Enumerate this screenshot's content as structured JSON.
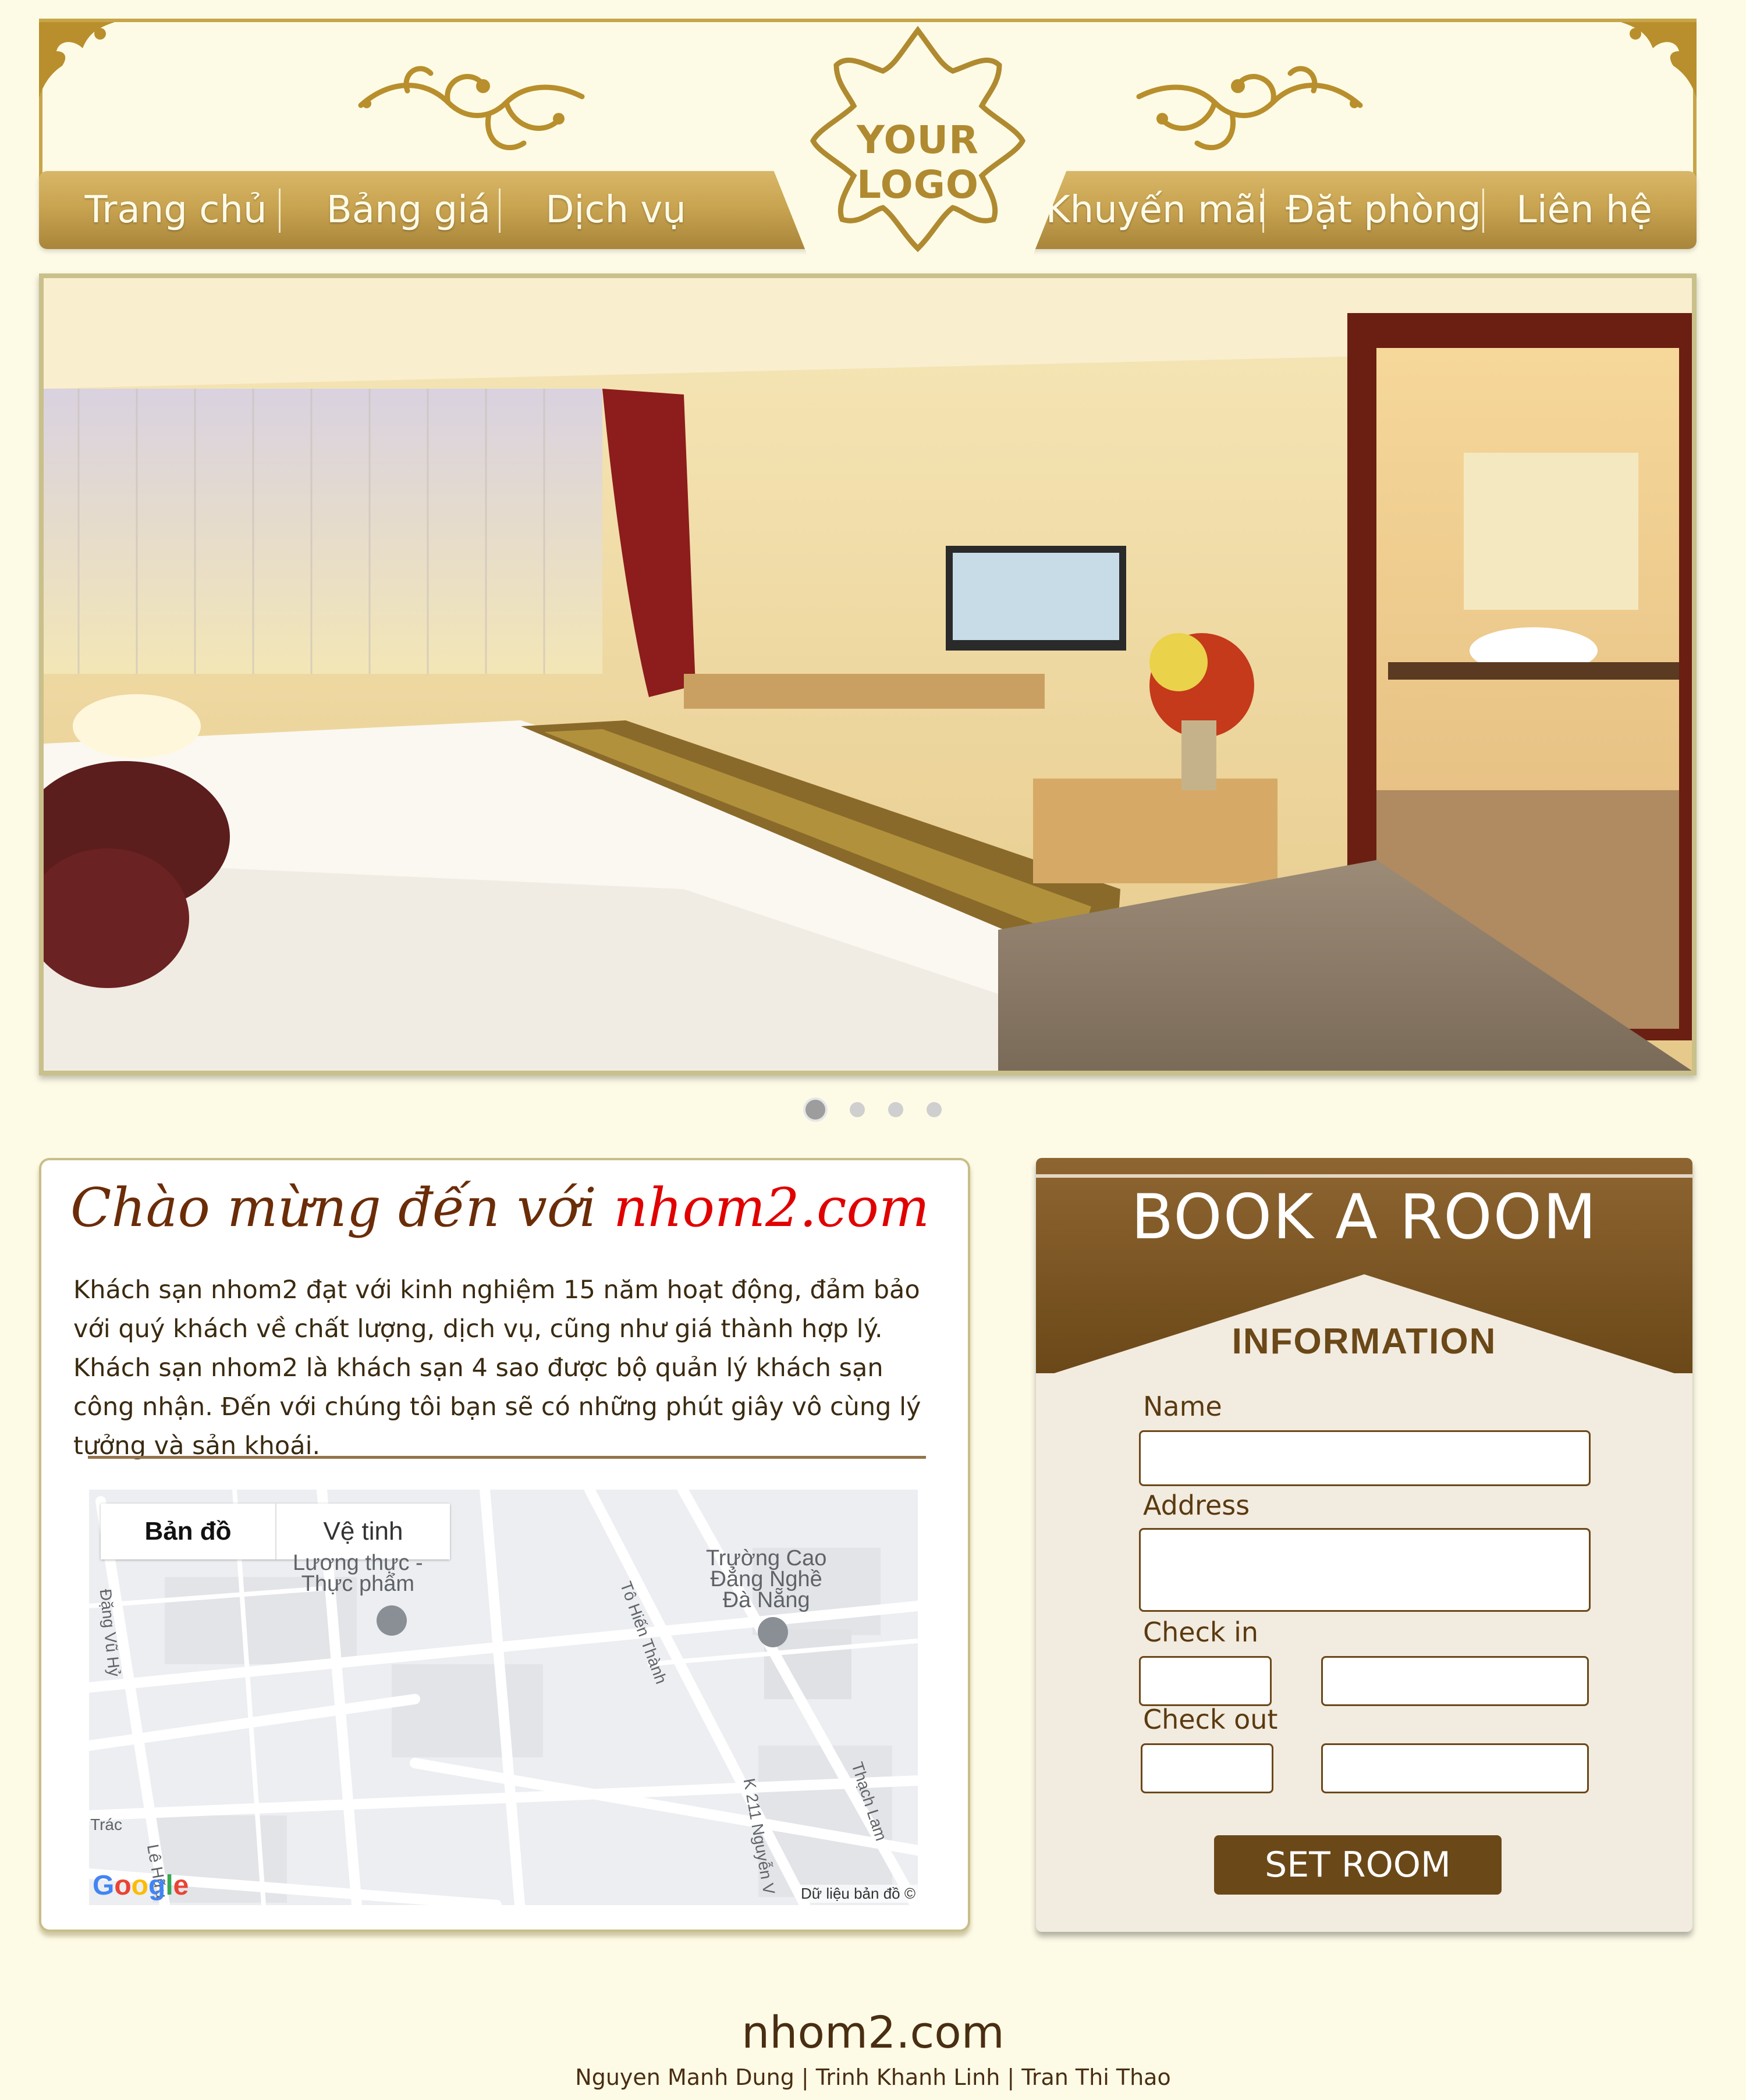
{
  "header": {
    "logo_text": "YOUR LOGO",
    "nav": [
      {
        "label": "Trang chủ"
      },
      {
        "label": "Bảng giá"
      },
      {
        "label": "Dịch vụ"
      },
      {
        "label": "Khuyến mãi"
      },
      {
        "label": "Đặt phòng"
      },
      {
        "label": "Liên hệ"
      }
    ],
    "colors": {
      "gold": "#c9a451",
      "gold_dark": "#a9853a",
      "background": "#fdfbe6"
    }
  },
  "slider": {
    "image_description_icon": "hotel-room-photo",
    "slide_count": 4,
    "active_slide": 1
  },
  "welcome": {
    "title_prefix": "Chào mừng đến với ",
    "title_brand": "nhom2.com",
    "paragraph1": "Khách sạn nhom2 đạt với kinh nghiệm 15 năm hoạt động, đảm bảo với quý khách về chất lượng, dịch vụ, cũng như giá thành hợp lý.",
    "paragraph2": "Khách sạn nhom2 là khách sạn 4 sao được bộ quản lý khách sạn công nhận. Đến với chúng tôi bạn sẽ có những phút giây vô cùng lý tưởng và sản khoái."
  },
  "map": {
    "tabs": [
      {
        "label": "Bản đồ",
        "active": true
      },
      {
        "label": "Vệ tinh",
        "active": false
      }
    ],
    "poi1": "Lương thực -\nThực phẩm",
    "poi2": "Trường Cao\nĐẳng Nghề\nĐà Nẵng",
    "roads": [
      "Đặng Vũ Hỷ",
      "Tô Hiến Thành",
      "K 211 Nguyễn V",
      "Thạch Lam",
      "Lê Hữu",
      "Trác"
    ],
    "google": "Google",
    "attribution": "Dữ liệu bản đồ ©"
  },
  "booking": {
    "title": "BOOK A ROOM",
    "subtitle": "INFORMATION",
    "name_label": "Name",
    "address_label": "Address",
    "checkin_label": "Check in",
    "checkout_label": "Check out",
    "submit_label": "SET ROOM",
    "colors": {
      "brown": "#6b4818",
      "panel": "#f2ebe0"
    }
  },
  "footer": {
    "site": "nhom2.com",
    "credits": "Nguyen Manh Dung  |  Trinh Khanh Linh  |  Tran Thi Thao"
  }
}
